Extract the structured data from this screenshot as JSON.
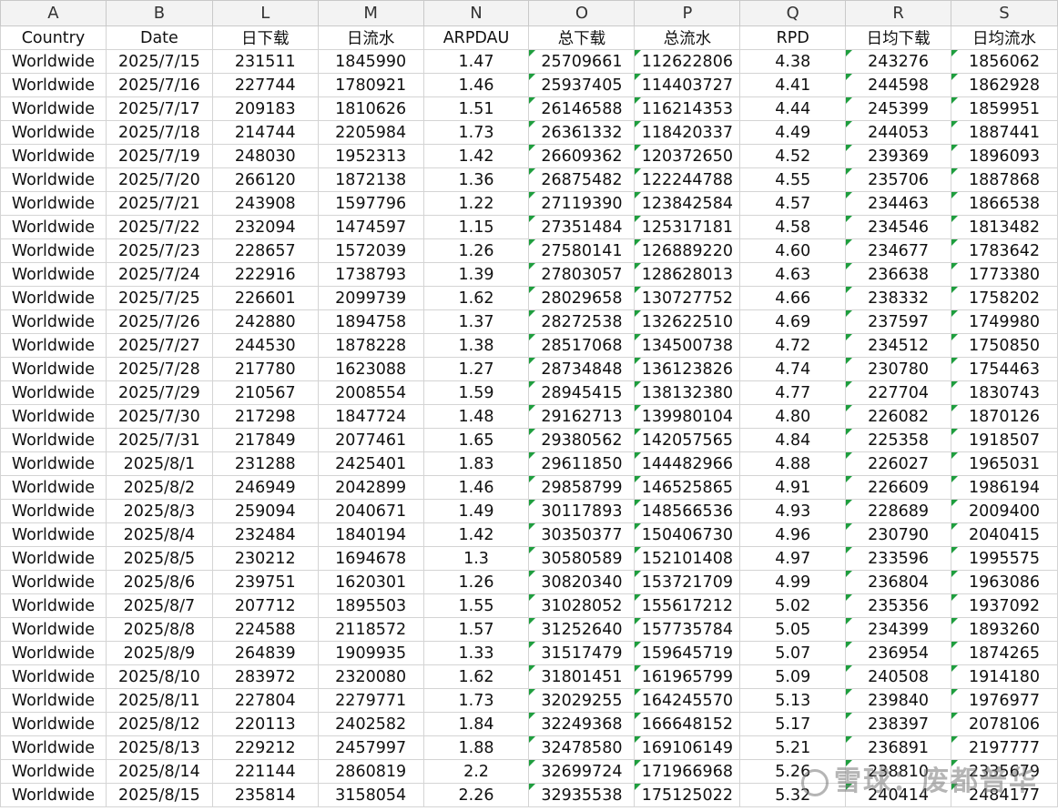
{
  "columns": [
    "A",
    "B",
    "L",
    "M",
    "N",
    "O",
    "P",
    "Q",
    "R",
    "S"
  ],
  "headers": [
    "Country",
    "Date",
    "日下载",
    "日流水",
    "ARPDAU",
    "总下载",
    "总流水",
    "RPD",
    "日均下载",
    "日均流水"
  ],
  "rows": [
    [
      "Worldwide",
      "2025/7/15",
      "231511",
      "1845990",
      "1.47",
      "25709661",
      "112622806",
      "4.38",
      "243276",
      "1856062"
    ],
    [
      "Worldwide",
      "2025/7/16",
      "227744",
      "1780921",
      "1.46",
      "25937405",
      "114403727",
      "4.41",
      "244598",
      "1862928"
    ],
    [
      "Worldwide",
      "2025/7/17",
      "209183",
      "1810626",
      "1.51",
      "26146588",
      "116214353",
      "4.44",
      "245399",
      "1859951"
    ],
    [
      "Worldwide",
      "2025/7/18",
      "214744",
      "2205984",
      "1.73",
      "26361332",
      "118420337",
      "4.49",
      "244053",
      "1887441"
    ],
    [
      "Worldwide",
      "2025/7/19",
      "248030",
      "1952313",
      "1.42",
      "26609362",
      "120372650",
      "4.52",
      "239369",
      "1896093"
    ],
    [
      "Worldwide",
      "2025/7/20",
      "266120",
      "1872138",
      "1.36",
      "26875482",
      "122244788",
      "4.55",
      "235706",
      "1887868"
    ],
    [
      "Worldwide",
      "2025/7/21",
      "243908",
      "1597796",
      "1.22",
      "27119390",
      "123842584",
      "4.57",
      "234463",
      "1866538"
    ],
    [
      "Worldwide",
      "2025/7/22",
      "232094",
      "1474597",
      "1.15",
      "27351484",
      "125317181",
      "4.58",
      "234546",
      "1813482"
    ],
    [
      "Worldwide",
      "2025/7/23",
      "228657",
      "1572039",
      "1.26",
      "27580141",
      "126889220",
      "4.60",
      "234677",
      "1783642"
    ],
    [
      "Worldwide",
      "2025/7/24",
      "222916",
      "1738793",
      "1.39",
      "27803057",
      "128628013",
      "4.63",
      "236638",
      "1773380"
    ],
    [
      "Worldwide",
      "2025/7/25",
      "226601",
      "2099739",
      "1.62",
      "28029658",
      "130727752",
      "4.66",
      "238332",
      "1758202"
    ],
    [
      "Worldwide",
      "2025/7/26",
      "242880",
      "1894758",
      "1.37",
      "28272538",
      "132622510",
      "4.69",
      "237597",
      "1749980"
    ],
    [
      "Worldwide",
      "2025/7/27",
      "244530",
      "1878228",
      "1.38",
      "28517068",
      "134500738",
      "4.72",
      "234512",
      "1750850"
    ],
    [
      "Worldwide",
      "2025/7/28",
      "217780",
      "1623088",
      "1.27",
      "28734848",
      "136123826",
      "4.74",
      "230780",
      "1754463"
    ],
    [
      "Worldwide",
      "2025/7/29",
      "210567",
      "2008554",
      "1.59",
      "28945415",
      "138132380",
      "4.77",
      "227704",
      "1830743"
    ],
    [
      "Worldwide",
      "2025/7/30",
      "217298",
      "1847724",
      "1.48",
      "29162713",
      "139980104",
      "4.80",
      "226082",
      "1870126"
    ],
    [
      "Worldwide",
      "2025/7/31",
      "217849",
      "2077461",
      "1.65",
      "29380562",
      "142057565",
      "4.84",
      "225358",
      "1918507"
    ],
    [
      "Worldwide",
      "2025/8/1",
      "231288",
      "2425401",
      "1.83",
      "29611850",
      "144482966",
      "4.88",
      "226027",
      "1965031"
    ],
    [
      "Worldwide",
      "2025/8/2",
      "246949",
      "2042899",
      "1.46",
      "29858799",
      "146525865",
      "4.91",
      "226609",
      "1986194"
    ],
    [
      "Worldwide",
      "2025/8/3",
      "259094",
      "2040671",
      "1.49",
      "30117893",
      "148566536",
      "4.93",
      "228689",
      "2009400"
    ],
    [
      "Worldwide",
      "2025/8/4",
      "232484",
      "1840194",
      "1.42",
      "30350377",
      "150406730",
      "4.96",
      "230790",
      "2040415"
    ],
    [
      "Worldwide",
      "2025/8/5",
      "230212",
      "1694678",
      "1.3",
      "30580589",
      "152101408",
      "4.97",
      "233596",
      "1995575"
    ],
    [
      "Worldwide",
      "2025/8/6",
      "239751",
      "1620301",
      "1.26",
      "30820340",
      "153721709",
      "4.99",
      "236804",
      "1963086"
    ],
    [
      "Worldwide",
      "2025/8/7",
      "207712",
      "1895503",
      "1.55",
      "31028052",
      "155617212",
      "5.02",
      "235356",
      "1937092"
    ],
    [
      "Worldwide",
      "2025/8/8",
      "224588",
      "2118572",
      "1.57",
      "31252640",
      "157735784",
      "5.05",
      "234399",
      "1893260"
    ],
    [
      "Worldwide",
      "2025/8/9",
      "264839",
      "1909935",
      "1.33",
      "31517479",
      "159645719",
      "5.07",
      "236954",
      "1874265"
    ],
    [
      "Worldwide",
      "2025/8/10",
      "283972",
      "2320080",
      "1.62",
      "31801451",
      "161965799",
      "5.09",
      "240508",
      "1914180"
    ],
    [
      "Worldwide",
      "2025/8/11",
      "227804",
      "2279771",
      "1.73",
      "32029255",
      "164245570",
      "5.13",
      "239840",
      "1976977"
    ],
    [
      "Worldwide",
      "2025/8/12",
      "220113",
      "2402582",
      "1.84",
      "32249368",
      "166648152",
      "5.17",
      "238397",
      "2078106"
    ],
    [
      "Worldwide",
      "2025/8/13",
      "229212",
      "2457997",
      "1.88",
      "32478580",
      "169106149",
      "5.21",
      "236891",
      "2197777"
    ],
    [
      "Worldwide",
      "2025/8/14",
      "221144",
      "2860819",
      "2.2",
      "32699724",
      "171966968",
      "5.26",
      "238810",
      "2335679"
    ],
    [
      "Worldwide",
      "2025/8/15",
      "235814",
      "3158054",
      "2.26",
      "32935538",
      "175125022",
      "5.32",
      "240414",
      "2484177"
    ]
  ],
  "flagged_columns": [
    5,
    6,
    8,
    9
  ],
  "flag_color": "#1e9e3e",
  "watermark": "雪球：废都普华",
  "watermark_icon": "snowball-logo-icon"
}
